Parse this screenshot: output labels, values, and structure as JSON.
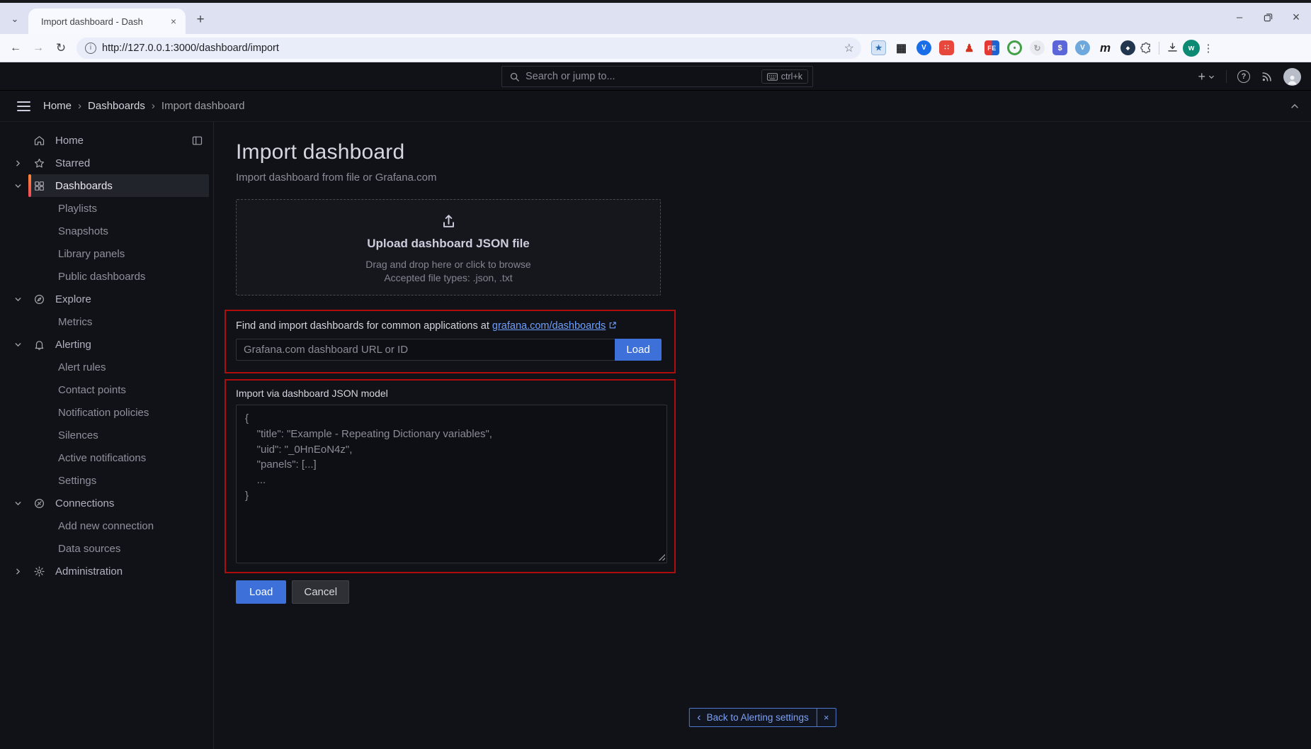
{
  "browser": {
    "tab_title": "Import dashboard - Dash",
    "url": "http://127.0.0.1:3000/dashboard/import",
    "avatar_initial": "w",
    "extensions": [
      {
        "name": "extension-star-box",
        "style": "box",
        "bg": "#d7e4f5",
        "border": "#91b6dc",
        "glyph": "★",
        "color": "#2a6db3",
        "size": 11
      },
      {
        "name": "extension-qr",
        "style": "plain",
        "glyph": "▦",
        "color": "#202124",
        "size": 16
      },
      {
        "name": "extension-v-balloon",
        "style": "circle",
        "bg": "#1a6fe8",
        "glyph": "V",
        "color": "#ffffff",
        "size": 10
      },
      {
        "name": "extension-dice",
        "style": "round",
        "bg": "#e8473c",
        "glyph": "∷",
        "color": "#ffffff",
        "size": 10
      },
      {
        "name": "extension-figure",
        "style": "plain",
        "glyph": "♟",
        "color": "#d03320",
        "size": 15
      },
      {
        "name": "extension-fe",
        "style": "fe",
        "glyph": "FE",
        "color": "#ffffff",
        "size": 9
      },
      {
        "name": "extension-green-ring",
        "style": "ring",
        "border": "#43a047",
        "glyph": "•",
        "color": "#43a047",
        "size": 11
      },
      {
        "name": "extension-sync",
        "style": "circle",
        "bg": "#e9ebf0",
        "glyph": "↻",
        "color": "#9aa0a6",
        "size": 12
      },
      {
        "name": "extension-blue-badge",
        "style": "round",
        "bg": "#5b67d8",
        "glyph": "$",
        "color": "#ffffff",
        "size": 11
      },
      {
        "name": "extension-v-circle",
        "style": "circle",
        "bg": "#6fa8dc",
        "glyph": "V",
        "color": "#ffffff",
        "size": 10
      },
      {
        "name": "extension-m",
        "style": "plain",
        "glyph": "m",
        "color": "#1b1b1b",
        "size": 17,
        "italic": true
      },
      {
        "name": "extension-dark-bubble",
        "style": "circle",
        "bg": "#22364e",
        "glyph": "◆",
        "color": "#ffffff",
        "size": 7
      }
    ]
  },
  "icons": {
    "close": "×",
    "plus": "+",
    "minus": "–",
    "back": "←",
    "forward": "→",
    "reload": "↻",
    "info": "i",
    "star": "☆",
    "dots": "⋮",
    "tab_caret": "⌄",
    "crumb_sep": "›",
    "toast_chevron": "‹",
    "question": "?"
  },
  "topnav": {
    "search_placeholder": "Search or jump to...",
    "shortcut": "ctrl+k"
  },
  "breadcrumb": {
    "items": [
      "Home",
      "Dashboards",
      "Import dashboard"
    ]
  },
  "sidebar": {
    "items": [
      {
        "label": "Home",
        "icon": "home",
        "trailing": "dock"
      },
      {
        "label": "Starred",
        "icon": "star",
        "chevron": "right"
      },
      {
        "label": "Dashboards",
        "icon": "grid",
        "chevron": "down",
        "active": true
      },
      {
        "label": "Playlists",
        "child": true
      },
      {
        "label": "Snapshots",
        "child": true
      },
      {
        "label": "Library panels",
        "child": true
      },
      {
        "label": "Public dashboards",
        "child": true
      },
      {
        "label": "Explore",
        "icon": "compass",
        "chevron": "down"
      },
      {
        "label": "Metrics",
        "child": true
      },
      {
        "label": "Alerting",
        "icon": "bell",
        "chevron": "down"
      },
      {
        "label": "Alert rules",
        "child": true
      },
      {
        "label": "Contact points",
        "child": true
      },
      {
        "label": "Notification policies",
        "child": true
      },
      {
        "label": "Silences",
        "child": true
      },
      {
        "label": "Active notifications",
        "child": true
      },
      {
        "label": "Settings",
        "child": true
      },
      {
        "label": "Connections",
        "icon": "plug",
        "chevron": "down"
      },
      {
        "label": "Add new connection",
        "child": true
      },
      {
        "label": "Data sources",
        "child": true
      },
      {
        "label": "Administration",
        "icon": "gear",
        "chevron": "right"
      }
    ]
  },
  "main": {
    "title": "Import dashboard",
    "subtitle": "Import dashboard from file or Grafana.com",
    "dropzone": {
      "title": "Upload dashboard JSON file",
      "hint": "Drag and drop here or click to browse",
      "accepted": "Accepted file types: .json, .txt"
    },
    "gcom": {
      "label_prefix": "Find and import dashboards for common applications at ",
      "link": "grafana.com/dashboards",
      "input_placeholder": "Grafana.com dashboard URL or ID",
      "load_label": "Load"
    },
    "json_section": {
      "label": "Import via dashboard JSON model",
      "placeholder": "{\n    \"title\": \"Example - Repeating Dictionary variables\",\n    \"uid\": \"_0HnEoN4z\",\n    \"panels\": [...]\n    ...\n}"
    },
    "buttons": {
      "load": "Load",
      "cancel": "Cancel"
    }
  },
  "toast": {
    "label": "Back to Alerting settings"
  },
  "colors": {
    "accent_orange": "#ff8833",
    "accent_red": "#f2495c",
    "annotation_red": "#ae0d0d",
    "primary_blue": "#3d71d9",
    "link_blue": "#6e9fff",
    "bg_dark": "#111217"
  }
}
